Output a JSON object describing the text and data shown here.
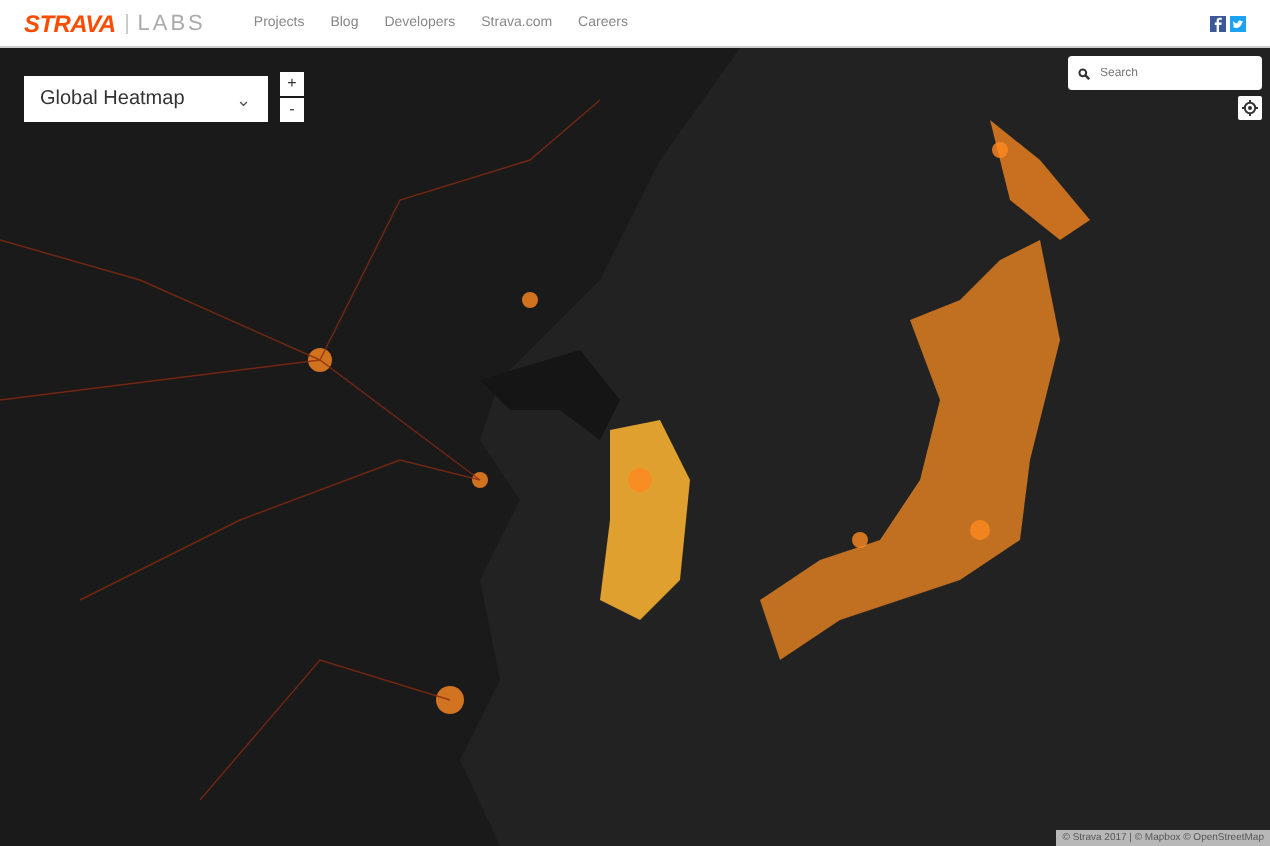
{
  "header": {
    "logo": "STRAVA",
    "sublogo": "LABS",
    "nav": [
      "Projects",
      "Blog",
      "Developers",
      "Strava.com",
      "Careers"
    ]
  },
  "map": {
    "layer_select": {
      "value": "Global Heatmap",
      "caret": "⌄"
    },
    "zoom": [
      "+",
      "-"
    ],
    "search": {
      "placeholder": "Search"
    },
    "attribution": "© Strava 2017 | © Mapbox © OpenStreetMap"
  }
}
